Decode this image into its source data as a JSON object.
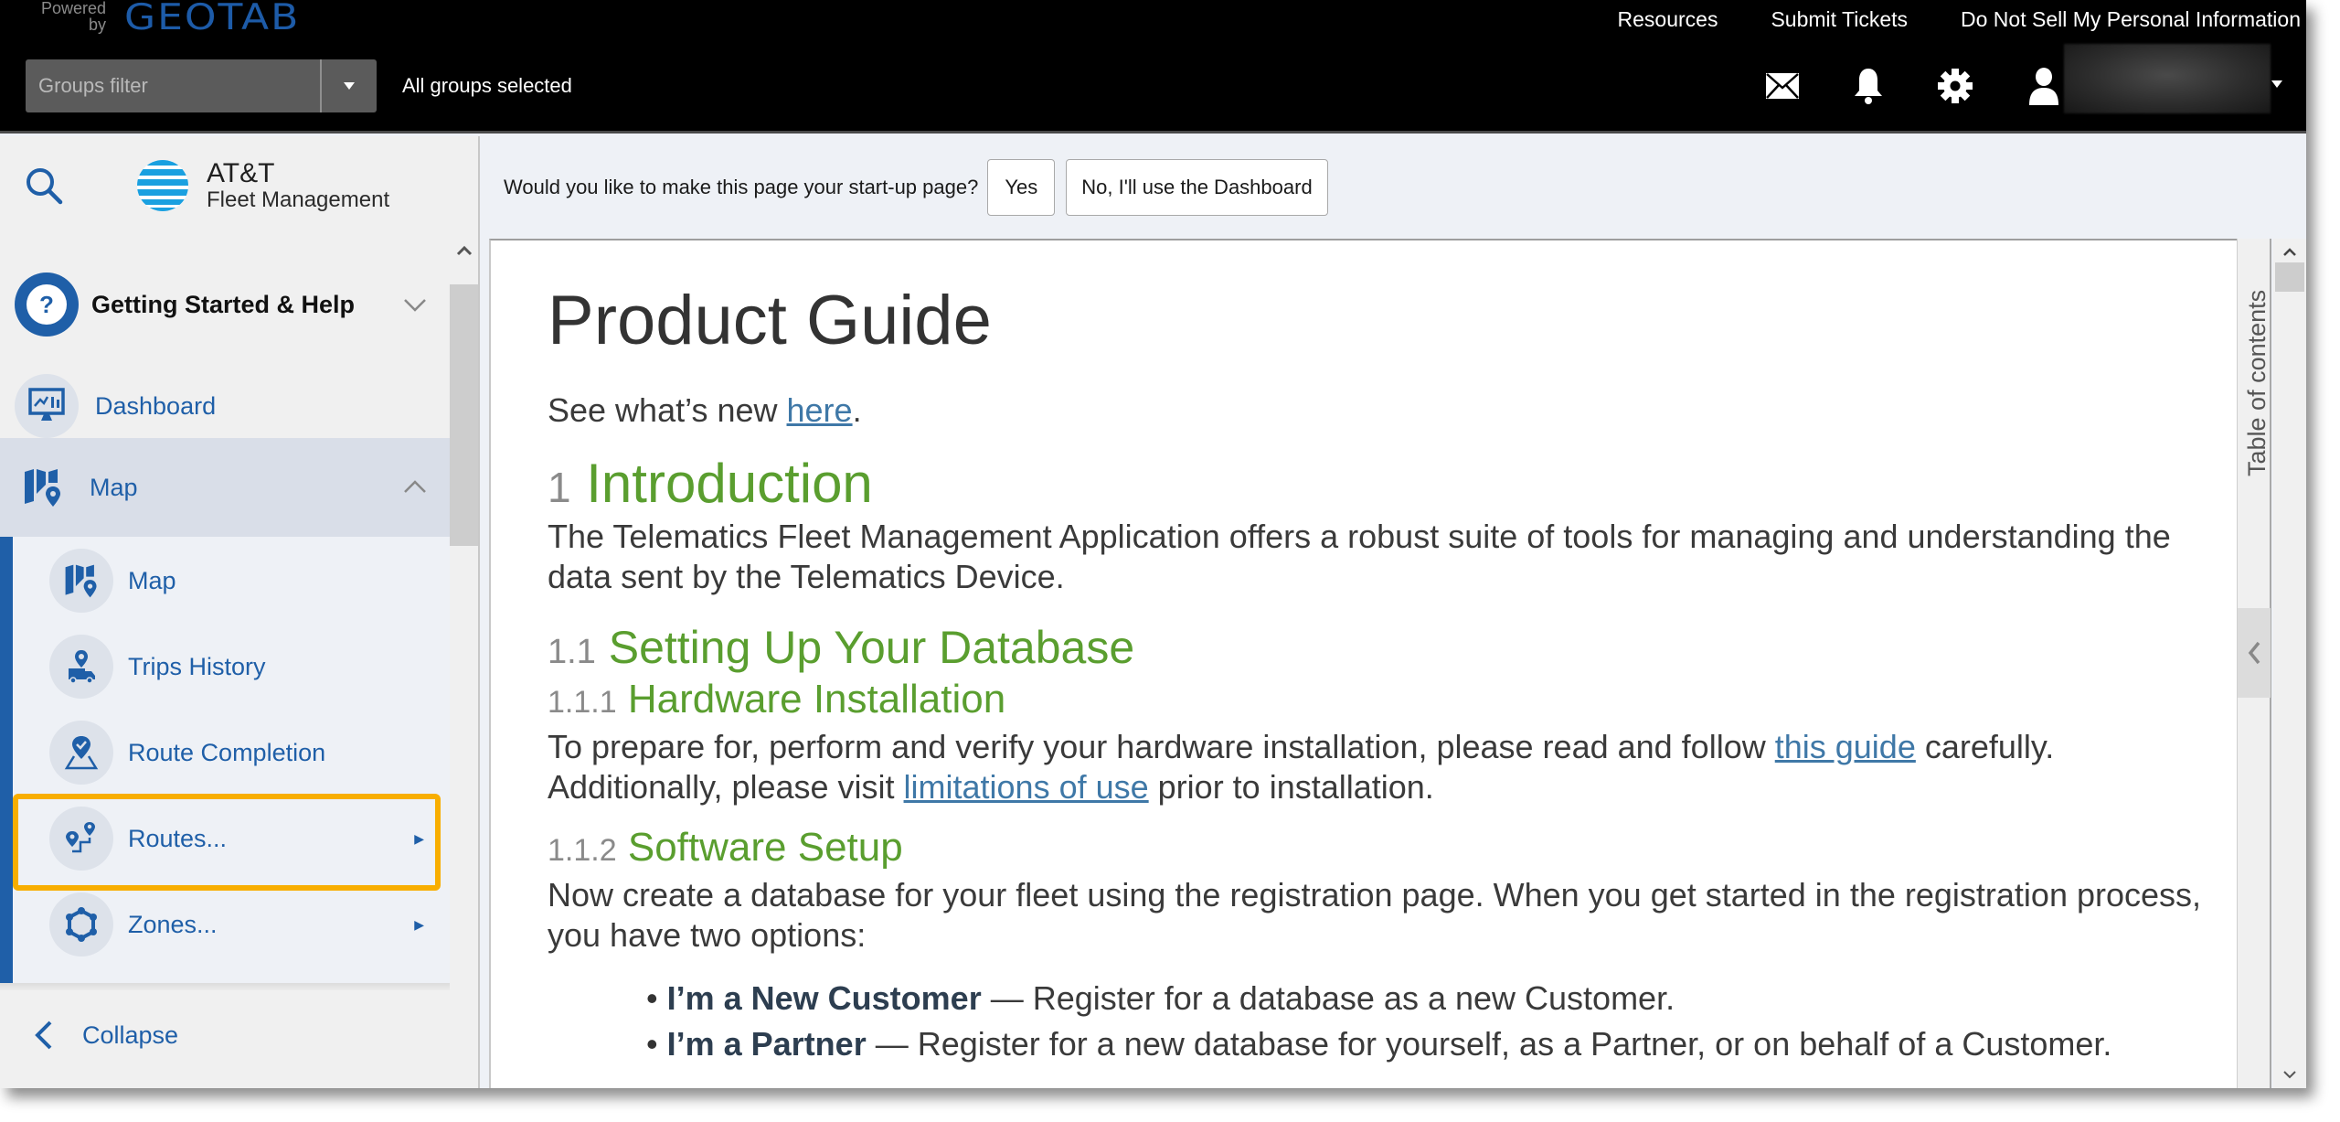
{
  "header": {
    "powered_by": "Powered by",
    "brand": "GEOTAB",
    "groups_filter_placeholder": "Groups filter",
    "groups_status": "All groups selected",
    "links": [
      "Resources",
      "Submit Tickets",
      "Do Not Sell My Personal Information"
    ],
    "icons": [
      "mail-icon",
      "bell-icon",
      "gear-icon",
      "user-icon"
    ],
    "user_name": ""
  },
  "sidebar": {
    "logo_line1": "AT&T",
    "logo_line2": "Fleet Management",
    "items": [
      {
        "label": "Getting Started & Help",
        "icon": "help-icon",
        "state": "collapsed"
      },
      {
        "label": "Dashboard",
        "icon": "dashboard-icon"
      },
      {
        "label": "Map",
        "icon": "map-icon",
        "state": "expanded"
      }
    ],
    "sub_items": [
      {
        "label": "Map",
        "icon": "map-icon"
      },
      {
        "label": "Trips History",
        "icon": "trips-history-icon"
      },
      {
        "label": "Route Completion",
        "icon": "route-completion-icon"
      },
      {
        "label": "Routes...",
        "icon": "routes-icon",
        "has_submenu": true,
        "highlighted": true
      },
      {
        "label": "Zones...",
        "icon": "zones-icon",
        "has_submenu": true
      }
    ],
    "collapse_label": "Collapse"
  },
  "startup_prompt": {
    "question": "Would you like to make this page your start-up page?",
    "yes_label": "Yes",
    "no_label": "No, I'll use the Dashboard"
  },
  "document": {
    "title": "Product Guide",
    "whats_new_prefix": "See what’s new ",
    "whats_new_link": "here",
    "whats_new_suffix": ".",
    "sections": {
      "s1": {
        "num": "1",
        "title": "Introduction",
        "body": "The Telematics Fleet Management Application offers a robust suite of tools for managing and understanding the data sent by the Telematics Device."
      },
      "s11": {
        "num": "1.1",
        "title": "Setting Up Your Database"
      },
      "s111": {
        "num": "1.1.1",
        "title": "Hardware Installation",
        "body_a": "To prepare for, perform and verify your hardware installation, please read and follow ",
        "link_a": "this guide",
        "body_b": " carefully. Additionally, please visit ",
        "link_b": "limitations of use",
        "body_c": " prior to installation."
      },
      "s112": {
        "num": "1.1.2",
        "title": "Software Setup",
        "body": "Now create a database for your fleet using the registration page. When you get started in the registration process, you have two options:",
        "options": [
          {
            "bold": "I’m a New Customer",
            "text": " — Register for a database as a new Customer."
          },
          {
            "bold": "I’m a Partner",
            "text": " — Register for a new database for yourself, as a Partner, or on behalf of a Customer."
          }
        ]
      }
    }
  },
  "toc": {
    "label": "Table of contents"
  },
  "colors": {
    "header_bg": "#000000",
    "brand_blue": "#1f5fa8",
    "heading_green": "#5a9e2f",
    "highlight_orange": "#f8ae00",
    "link_blue": "#3f78a7"
  }
}
